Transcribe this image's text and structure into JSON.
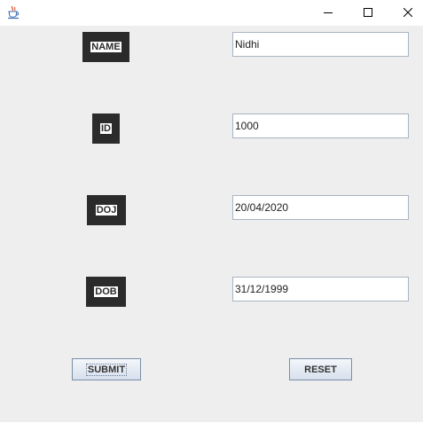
{
  "titlebar": {
    "icons": {
      "app": "java-cup-icon",
      "minimize": "minimize-icon",
      "maximize": "maximize-icon",
      "close": "close-icon"
    }
  },
  "form": {
    "name_label": "NAME",
    "id_label": "ID",
    "doj_label": "DOJ",
    "dob_label": "DOB",
    "name_value": "Nidhi",
    "id_value": "1000",
    "doj_value": "20/04/2020",
    "dob_value": "31/12/1999"
  },
  "buttons": {
    "submit_label": "SUBMIT",
    "reset_label": "RESET"
  },
  "colors": {
    "label_bg": "#2b2b2b",
    "panel_bg": "#eeeeee",
    "field_border": "#a9b4c2"
  }
}
